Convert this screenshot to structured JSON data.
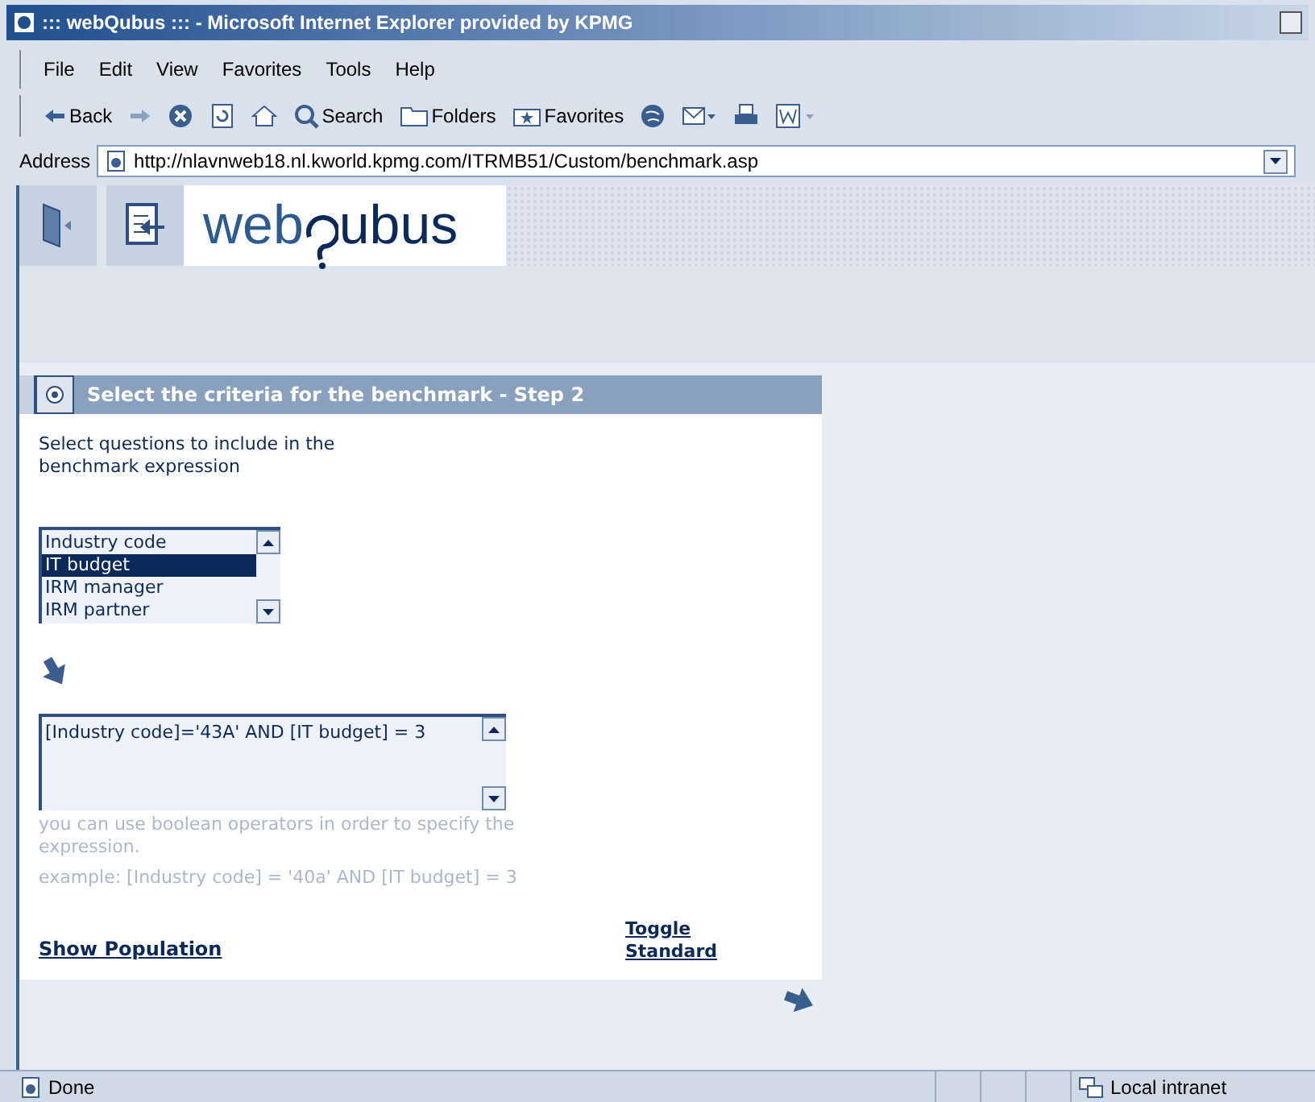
{
  "window": {
    "title": "::: webQubus ::: - Microsoft Internet Explorer provided by KPMG"
  },
  "menu": [
    "File",
    "Edit",
    "View",
    "Favorites",
    "Tools",
    "Help"
  ],
  "toolbar": [
    {
      "kind": "back",
      "label": "Back"
    },
    {
      "kind": "forward"
    },
    {
      "kind": "stop"
    },
    {
      "kind": "refresh"
    },
    {
      "kind": "home"
    },
    {
      "kind": "search",
      "label": "Search"
    },
    {
      "kind": "folders",
      "label": "Folders"
    },
    {
      "kind": "favorites",
      "label": "Favorites"
    },
    {
      "kind": "media"
    },
    {
      "kind": "mail"
    },
    {
      "kind": "print"
    },
    {
      "kind": "edit"
    }
  ],
  "address": {
    "label": "Address",
    "value": "http://nlavnweb18.nl.kworld.kpmg.com/ITRMB51/Custom/benchmark.asp"
  },
  "logo": {
    "before": "web",
    "after": "ubus"
  },
  "panel": {
    "title": "Select the criteria for the benchmark - Step 2",
    "instruction": "Select questions to include in the benchmark expression",
    "questions": [
      {
        "label": "Industry code",
        "selected": false
      },
      {
        "label": "IT budget",
        "selected": true
      },
      {
        "label": "IRM manager",
        "selected": false
      },
      {
        "label": "IRM partner",
        "selected": false
      }
    ],
    "expression": "[Industry code]='43A' AND [IT budget] = 3",
    "hint": "you can use boolean operators in order to specify the expression.",
    "example": "example: [Industry code] = '40a' AND [IT budget] = 3",
    "show_population": "Show Population",
    "toggle_standard": "Toggle Standard"
  },
  "status_bar": {
    "text": "Done",
    "zone": "Local intranet"
  }
}
